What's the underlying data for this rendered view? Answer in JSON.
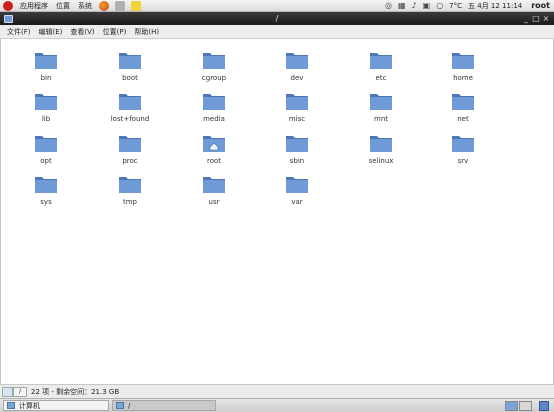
{
  "top_panel": {
    "menus": [
      "应用程序",
      "位置",
      "系统"
    ],
    "weather": "7°C",
    "datetime": "五 4月 12 11:14",
    "user": "root"
  },
  "window": {
    "title": "/",
    "controls": [
      "_",
      "□",
      "×"
    ]
  },
  "menubar": {
    "items": [
      "文件(F)",
      "编辑(E)",
      "查看(V)",
      "位置(P)",
      "帮助(H)"
    ]
  },
  "folders": [
    "bin",
    "boot",
    "cgroup",
    "dev",
    "etc",
    "home",
    "lib",
    "lost+found",
    "media",
    "misc",
    "mnt",
    "net",
    "opt",
    "proc",
    "root",
    "sbin",
    "selinux",
    "srv",
    "sys",
    "tmp",
    "usr",
    "var"
  ],
  "statusbar": {
    "dropdown": "/",
    "text": "22 项 - 剩余空间：21.3 GB"
  },
  "taskbar": {
    "tasks": [
      "计算机",
      "/"
    ]
  },
  "colors": {
    "folder_fill": "#6f9ad6",
    "folder_dark": "#4c78b8",
    "titlebar": "#1f1f1f"
  }
}
